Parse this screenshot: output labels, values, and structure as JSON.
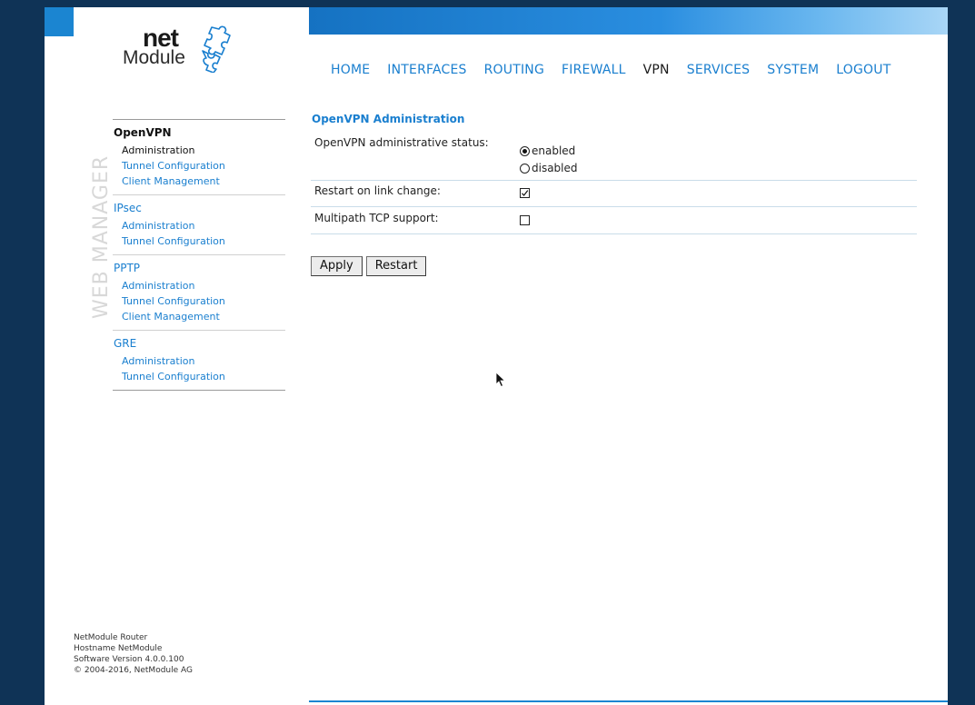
{
  "brand": {
    "logo_net": "net",
    "logo_module": "Module",
    "watermark": "WEB MANAGER",
    "accent_color": "#1a7fcf",
    "frame_color": "#0f3356"
  },
  "nav": {
    "items": [
      {
        "label": "HOME"
      },
      {
        "label": "INTERFACES"
      },
      {
        "label": "ROUTING"
      },
      {
        "label": "FIREWALL"
      },
      {
        "label": "VPN",
        "active": true
      },
      {
        "label": "SERVICES"
      },
      {
        "label": "SYSTEM"
      },
      {
        "label": "LOGOUT"
      }
    ]
  },
  "sidebar": {
    "groups": [
      {
        "title": "OpenVPN",
        "items": [
          "Administration",
          "Tunnel Configuration",
          "Client Management"
        ]
      },
      {
        "title": "IPsec",
        "items": [
          "Administration",
          "Tunnel Configuration"
        ]
      },
      {
        "title": "PPTP",
        "items": [
          "Administration",
          "Tunnel Configuration",
          "Client Management"
        ]
      },
      {
        "title": "GRE",
        "items": [
          "Administration",
          "Tunnel Configuration"
        ]
      }
    ]
  },
  "main": {
    "title": "OpenVPN Administration",
    "status_label": "OpenVPN administrative status:",
    "status_options": [
      "enabled",
      "disabled"
    ],
    "status_selected": "enabled",
    "restart_label": "Restart on link change:",
    "restart_checked": true,
    "multipath_label": "Multipath TCP support:",
    "multipath_checked": false,
    "apply_label": "Apply",
    "restart_button_label": "Restart"
  },
  "footer": {
    "line1": "NetModule Router",
    "line2": "Hostname NetModule",
    "line3": "Software Version 4.0.0.100",
    "line4": "© 2004-2016, NetModule AG"
  }
}
